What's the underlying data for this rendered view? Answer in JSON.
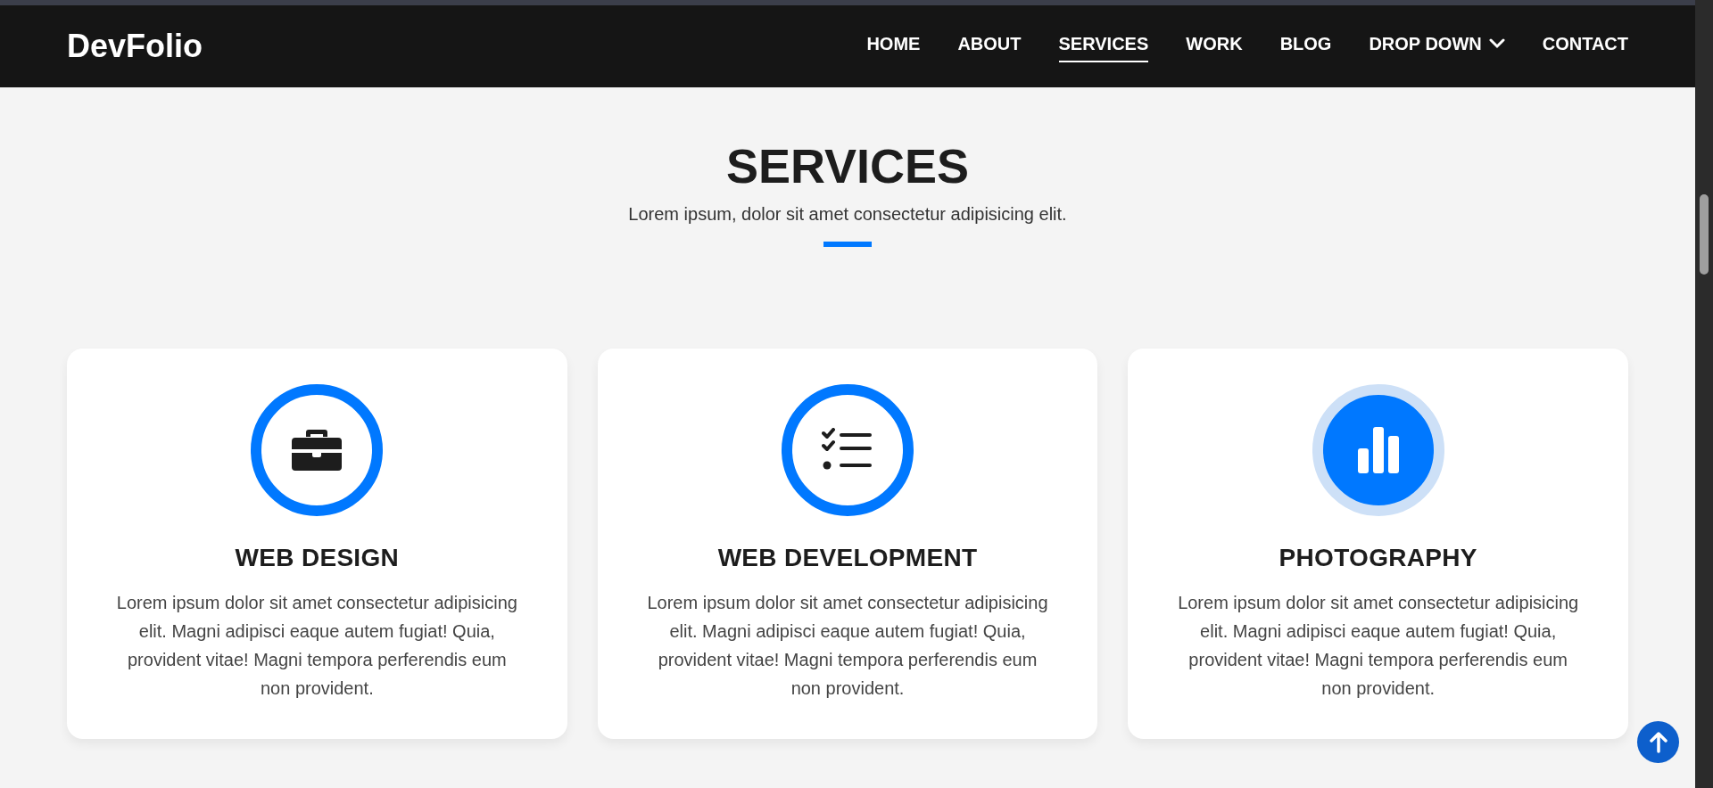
{
  "navbar": {
    "brand": "DevFolio",
    "items": [
      {
        "label": "HOME",
        "selected": false,
        "kind": "link"
      },
      {
        "label": "ABOUT",
        "selected": false,
        "kind": "link"
      },
      {
        "label": "SERVICES",
        "selected": true,
        "kind": "link"
      },
      {
        "label": "WORK",
        "selected": false,
        "kind": "link"
      },
      {
        "label": "BLOG",
        "selected": false,
        "kind": "link"
      },
      {
        "label": "DROP DOWN",
        "selected": false,
        "kind": "dropdown"
      },
      {
        "label": "CONTACT",
        "selected": false,
        "kind": "link"
      }
    ]
  },
  "section": {
    "title": "SERVICES",
    "subtitle": "Lorem ipsum, dolor sit amet consectetur adipisicing elit."
  },
  "services": [
    {
      "title": "WEB DESIGN",
      "kind": "briefcase",
      "highlighted": false,
      "text": "Lorem ipsum dolor sit amet consectetur adipisicing elit. Magni adipisci eaque autem fugiat! Quia, provident vitae! Magni tempora perferendis eum non provident."
    },
    {
      "title": "WEB DEVELOPMENT",
      "kind": "checklist",
      "highlighted": false,
      "text": "Lorem ipsum dolor sit amet consectetur adipisicing elit. Magni adipisci eaque autem fugiat! Quia, provident vitae! Magni tempora perferendis eum non provident."
    },
    {
      "title": "PHOTOGRAPHY",
      "kind": "bar-chart",
      "highlighted": true,
      "text": "Lorem ipsum dolor sit amet consectetur adipisicing elit. Magni adipisci eaque autem fugiat! Quia, provident vitae! Magni tempora perferendis eum non provident."
    }
  ]
}
